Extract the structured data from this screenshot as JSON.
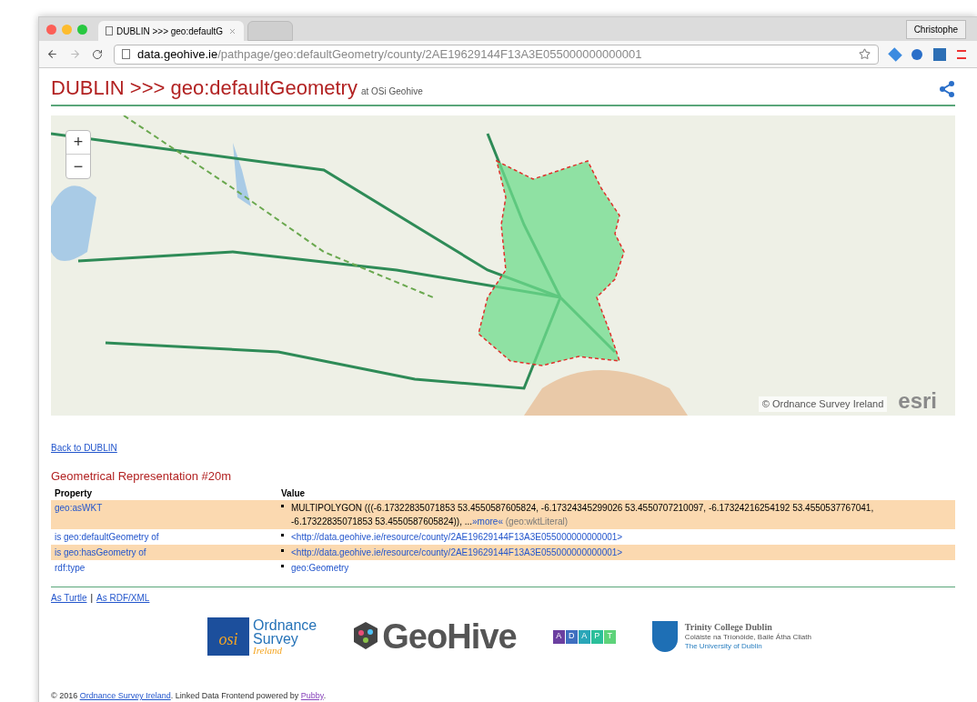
{
  "browser": {
    "tabs": [
      {
        "title": "DUBLIN >>> geo:defaultG",
        "selected": true
      },
      {
        "selected": false
      }
    ],
    "profile": "Christophe",
    "url_host": "data.geohive.ie",
    "url_path": "/pathpage/geo:defaultGeometry/county/2AE19629144F13A3E055000000000001"
  },
  "header": {
    "title": "DUBLIN >>> geo:defaultGeometry",
    "subtitle": "at OSi Geohive"
  },
  "map": {
    "zoom_in": "+",
    "zoom_out": "−",
    "attribution": "© Ordnance Survey Ireland",
    "logo": "esri"
  },
  "back_link": "Back to DUBLIN",
  "section_title": "Geometrical Representation #20m",
  "table": {
    "columns": [
      "Property",
      "Value"
    ],
    "rows": [
      {
        "property": "geo:asWKT",
        "prefix": "",
        "suffix": "",
        "value": "MULTIPOLYGON (((-6.17322835071853 53.4550587605824, -6.17324345299026 53.4550707210097, -6.17324216254192 53.4550537767041, -6.17322835071853 53.4550587605824)), ...",
        "more": "»more«",
        "datatype": "(geo:wktLiteral)",
        "kind": "literal"
      },
      {
        "property": "geo:defaultGeometry",
        "prefix": "is ",
        "suffix": " of",
        "value": "<http://data.geohive.ie/resource/county/2AE19629144F13A3E055000000000001>",
        "kind": "link"
      },
      {
        "property": "geo:hasGeometry",
        "prefix": "is ",
        "suffix": " of",
        "value": "<http://data.geohive.ie/resource/county/2AE19629144F13A3E055000000000001>",
        "kind": "link"
      },
      {
        "property": "rdf:type",
        "prefix": "",
        "suffix": "",
        "value": "geo:Geometry",
        "kind": "link"
      }
    ]
  },
  "formats": [
    {
      "label": "As Turtle"
    },
    {
      "label": "As RDF/XML"
    }
  ],
  "format_separator": "|",
  "logos": {
    "osi": {
      "mark": "osi",
      "line1": "Ordnance",
      "line2": "Survey",
      "line3": "Ireland"
    },
    "geohive": "GeoHive",
    "adapt": [
      "A",
      "D",
      "A",
      "P",
      "T"
    ],
    "tcd": {
      "name": "Trinity College Dublin",
      "irish": "Coláiste na Tríonóide, Baile Átha Cliath",
      "english": "The University of Dublin"
    }
  },
  "footer": {
    "prefix": "© 2016 ",
    "link": "Ordnance Survey Ireland",
    "middle": ". Linked Data Frontend powered by ",
    "link2": "Pubby",
    "suffix": "."
  }
}
